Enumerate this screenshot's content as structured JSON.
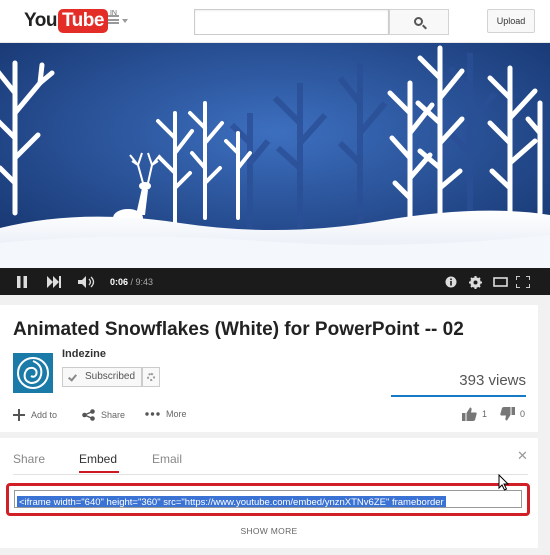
{
  "masthead": {
    "logo_you": "You",
    "logo_tube": "Tube",
    "logo_region": "IN",
    "search_value": "",
    "search_placeholder": "",
    "upload_label": "Upload"
  },
  "player": {
    "current_time": "0:06",
    "separator": " / ",
    "duration": "9:43",
    "played_fraction": 0.011,
    "loaded_fraction": 0.03
  },
  "video": {
    "title": "Animated Snowflakes (White) for PowerPoint -- 02",
    "channel": "Indezine",
    "subscribe_label": "Subscribed",
    "views": "393 views"
  },
  "actions": {
    "add_to": "Add to",
    "share": "Share",
    "more": "More",
    "likes": "1",
    "dislikes": "0"
  },
  "share_panel": {
    "tabs": [
      "Share",
      "Embed",
      "Email"
    ],
    "active_tab": "Embed",
    "embed_code": "<iframe width=\"640\" height=\"360\" src=\"https://www.youtube.com/embed/ynznXTNv6ZE\" frameborder",
    "show_more": "SHOW MORE"
  },
  "colors": {
    "brand_red": "#e52d27",
    "highlight_red": "#d01f26",
    "accent_blue": "#167ac6",
    "selection_blue": "#3b73d5"
  }
}
